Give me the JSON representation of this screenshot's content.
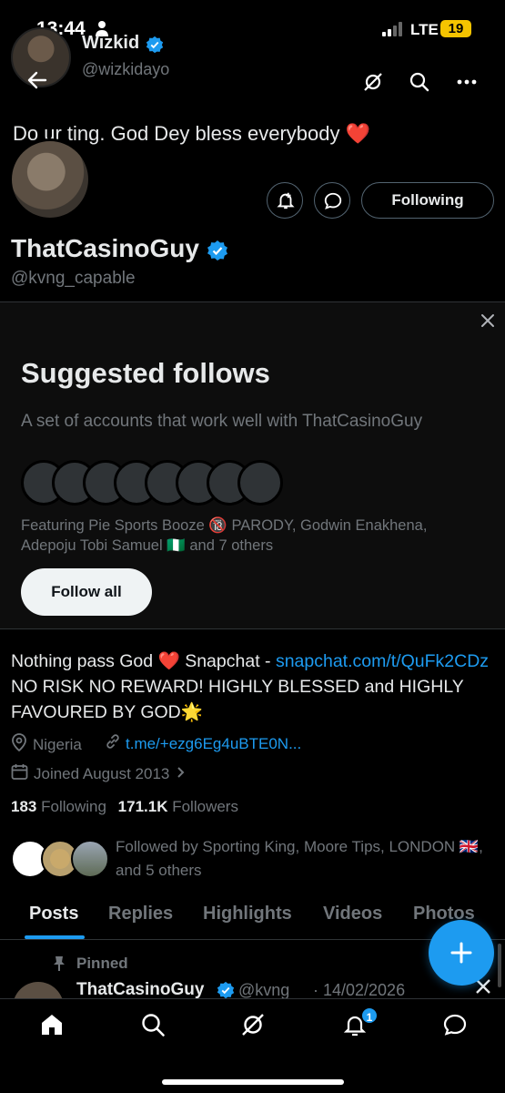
{
  "status_bar": {
    "time": "13:44",
    "network": "LTE",
    "battery": "19"
  },
  "header": {
    "name": "Wizkid",
    "handle": "@wizkidayo"
  },
  "bio_preview": "Do ur ting. God Dey bless everybody ❤️",
  "profile": {
    "name": "ThatCasinoGuy",
    "handle": "@kvng_capable",
    "following_button": "Following",
    "bio_part1": "Nothing pass God ❤️  Snapchat - ",
    "bio_link": "snapchat.com/t/QuFk2CDz",
    "bio_part2": " NO RISK NO REWARD! HIGHLY BLESSED and HIGHLY FAVOURED BY GOD🌟",
    "location": "Nigeria",
    "website": "t.me/+ezg6Eg4uBTE0N...",
    "joined": "Joined August 2013",
    "following_count": "183",
    "following_label": "Following",
    "followers_count": "171.1K",
    "followers_label": "Followers",
    "followed_by": "Followed by Sporting King, Moore Tips, LONDON 🇬🇧, and 5 others"
  },
  "suggested": {
    "title": "Suggested follows",
    "subtitle": "A set of accounts that work well with ThatCasinoGuy",
    "featuring": "Featuring Pie Sports Booze 🔞 PARODY, Godwin Enakhena, Adepoju Tobi Samuel 🇳🇬 and 7 others",
    "follow_all": "Follow all"
  },
  "tabs": [
    "Posts",
    "Replies",
    "Highlights",
    "Videos",
    "Photos"
  ],
  "pinned": {
    "label": "Pinned",
    "name": "ThatCasinoGuy",
    "handle": "@kvng",
    "date": "· 14/02/2026"
  },
  "nav": {
    "notifications_badge": "1"
  },
  "colors": {
    "accent": "#1d9bf0",
    "background": "#000000",
    "muted": "#71767b"
  }
}
